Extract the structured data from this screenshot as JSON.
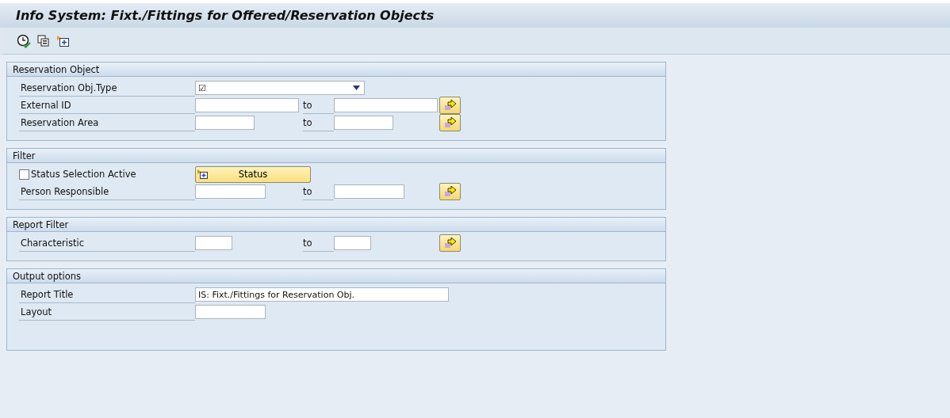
{
  "window": {
    "title": "Info System: Fixt./Fittings for Offered/Reservation Objects"
  },
  "sections": [
    {
      "title": "Reservation Object",
      "rows": [
        {
          "kind": "dropdown",
          "label": "Reservation Obj.Type",
          "value": "☑"
        },
        {
          "kind": "range",
          "label": "External ID",
          "to": "to"
        },
        {
          "kind": "range",
          "label": "Reservation Area",
          "to": "to"
        }
      ]
    },
    {
      "title": "Filter",
      "rows": [
        {
          "kind": "checkbox",
          "label": "Status Selection Active",
          "checked": false,
          "button": "Status"
        },
        {
          "kind": "range",
          "label": "Person Responsible",
          "to": "to"
        }
      ]
    },
    {
      "title": "Report Filter",
      "rows": [
        {
          "kind": "range",
          "label": "Characteristic",
          "to": "to"
        }
      ]
    },
    {
      "title": "Output options",
      "rows": [
        {
          "kind": "single",
          "label": "Report Title",
          "value": "IS: Fixt./Fittings for Reservation Obj."
        },
        {
          "kind": "single",
          "label": "Layout"
        }
      ]
    }
  ]
}
